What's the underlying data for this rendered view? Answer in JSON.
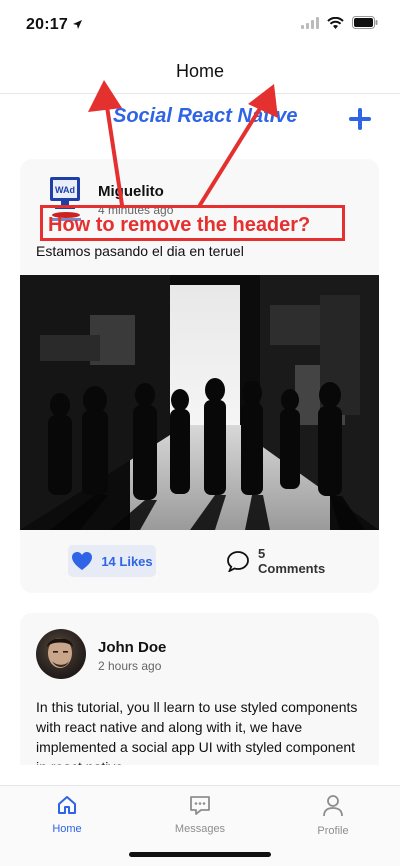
{
  "status_bar": {
    "time": "20:17"
  },
  "header": {
    "title": "Home"
  },
  "app": {
    "title": "Social React Native"
  },
  "posts": [
    {
      "user": "Miguelito",
      "time": "4 minutes ago",
      "text": "Estamos pasando el dia en teruel",
      "likes_label": "14 Likes",
      "comments_label": "5 Comments"
    },
    {
      "user": "John Doe",
      "time": "2 hours ago",
      "text": "In this tutorial, you ll learn to use styled components with react native and along with it, we have implemented a social app UI with styled component in react native."
    }
  ],
  "annotation": {
    "text": "How to remove the header?"
  },
  "tabs": [
    {
      "label": "Home",
      "icon": "home-icon",
      "active": true
    },
    {
      "label": "Messages",
      "icon": "messages-icon",
      "active": false
    },
    {
      "label": "Profile",
      "icon": "profile-icon",
      "active": false
    }
  ],
  "colors": {
    "accent": "#2e64e5",
    "annotation": "#e53030"
  }
}
